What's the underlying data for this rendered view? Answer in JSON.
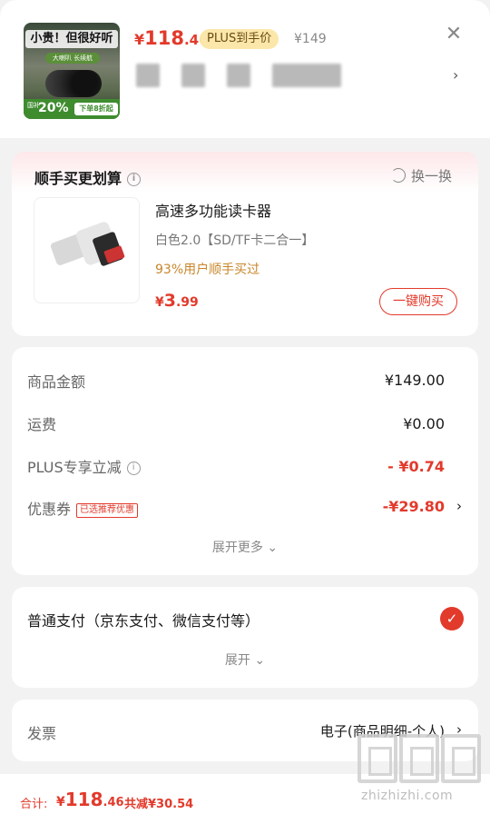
{
  "product": {
    "thumb_title": "小贵！但很好听",
    "thumb_sub": "大喇叭 长续航",
    "thumb_band_left": "国补",
    "thumb_band_pct": "20%",
    "thumb_band_right": "下单8折起",
    "price_currency": "¥",
    "price_int": "118",
    "price_dec": ".46",
    "plus_badge": "PLUS到手价",
    "original_price": "¥149"
  },
  "recommend": {
    "title": "顺手买更划算",
    "swap_label": "换一换",
    "item_name": "高速多功能读卡器",
    "item_spec": "白色2.0【SD/TF卡二合一】",
    "item_bought": "93%用户顺手买过",
    "price_currency": "¥",
    "price_int": "3",
    "price_dec": ".99",
    "buy_label": "一键购买"
  },
  "summary": {
    "goods_label": "商品金额",
    "goods_value": "¥149.00",
    "shipping_label": "运费",
    "shipping_value": "¥0.00",
    "plus_label": "PLUS专享立减",
    "plus_value": "- ¥0.74",
    "coupon_label": "优惠券",
    "coupon_tag": "已选推荐优惠",
    "coupon_value": "-¥29.80",
    "expand_more": "展开更多"
  },
  "payment": {
    "label": "普通支付（京东支付、微信支付等）",
    "expand": "展开"
  },
  "invoice": {
    "label": "发票",
    "value": "电子(商品明细-个人)"
  },
  "footer": {
    "total_label": "合计:",
    "total_currency": "¥",
    "total_int": "118",
    "total_dec": ".46",
    "total_saved": "共减¥30.54"
  },
  "watermark": {
    "text": "zhizhizhi.com"
  },
  "colors": {
    "accent": "#e23a2b",
    "plus_badge_bg": "#fbe7a9",
    "gold_text": "#c8862a"
  }
}
